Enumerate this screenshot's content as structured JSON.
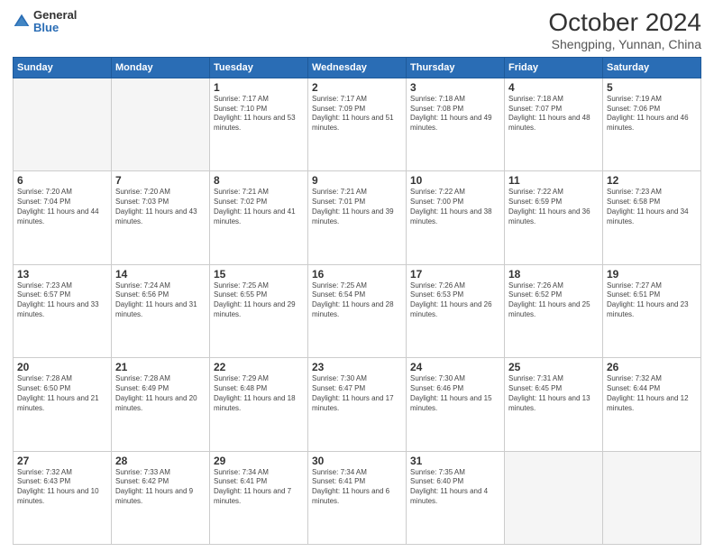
{
  "logo": {
    "general": "General",
    "blue": "Blue"
  },
  "title": "October 2024",
  "subtitle": "Shengping, Yunnan, China",
  "header_days": [
    "Sunday",
    "Monday",
    "Tuesday",
    "Wednesday",
    "Thursday",
    "Friday",
    "Saturday"
  ],
  "weeks": [
    [
      {
        "day": "",
        "sunrise": "",
        "sunset": "",
        "daylight": ""
      },
      {
        "day": "",
        "sunrise": "",
        "sunset": "",
        "daylight": ""
      },
      {
        "day": "1",
        "sunrise": "Sunrise: 7:17 AM",
        "sunset": "Sunset: 7:10 PM",
        "daylight": "Daylight: 11 hours and 53 minutes."
      },
      {
        "day": "2",
        "sunrise": "Sunrise: 7:17 AM",
        "sunset": "Sunset: 7:09 PM",
        "daylight": "Daylight: 11 hours and 51 minutes."
      },
      {
        "day": "3",
        "sunrise": "Sunrise: 7:18 AM",
        "sunset": "Sunset: 7:08 PM",
        "daylight": "Daylight: 11 hours and 49 minutes."
      },
      {
        "day": "4",
        "sunrise": "Sunrise: 7:18 AM",
        "sunset": "Sunset: 7:07 PM",
        "daylight": "Daylight: 11 hours and 48 minutes."
      },
      {
        "day": "5",
        "sunrise": "Sunrise: 7:19 AM",
        "sunset": "Sunset: 7:06 PM",
        "daylight": "Daylight: 11 hours and 46 minutes."
      }
    ],
    [
      {
        "day": "6",
        "sunrise": "Sunrise: 7:20 AM",
        "sunset": "Sunset: 7:04 PM",
        "daylight": "Daylight: 11 hours and 44 minutes."
      },
      {
        "day": "7",
        "sunrise": "Sunrise: 7:20 AM",
        "sunset": "Sunset: 7:03 PM",
        "daylight": "Daylight: 11 hours and 43 minutes."
      },
      {
        "day": "8",
        "sunrise": "Sunrise: 7:21 AM",
        "sunset": "Sunset: 7:02 PM",
        "daylight": "Daylight: 11 hours and 41 minutes."
      },
      {
        "day": "9",
        "sunrise": "Sunrise: 7:21 AM",
        "sunset": "Sunset: 7:01 PM",
        "daylight": "Daylight: 11 hours and 39 minutes."
      },
      {
        "day": "10",
        "sunrise": "Sunrise: 7:22 AM",
        "sunset": "Sunset: 7:00 PM",
        "daylight": "Daylight: 11 hours and 38 minutes."
      },
      {
        "day": "11",
        "sunrise": "Sunrise: 7:22 AM",
        "sunset": "Sunset: 6:59 PM",
        "daylight": "Daylight: 11 hours and 36 minutes."
      },
      {
        "day": "12",
        "sunrise": "Sunrise: 7:23 AM",
        "sunset": "Sunset: 6:58 PM",
        "daylight": "Daylight: 11 hours and 34 minutes."
      }
    ],
    [
      {
        "day": "13",
        "sunrise": "Sunrise: 7:23 AM",
        "sunset": "Sunset: 6:57 PM",
        "daylight": "Daylight: 11 hours and 33 minutes."
      },
      {
        "day": "14",
        "sunrise": "Sunrise: 7:24 AM",
        "sunset": "Sunset: 6:56 PM",
        "daylight": "Daylight: 11 hours and 31 minutes."
      },
      {
        "day": "15",
        "sunrise": "Sunrise: 7:25 AM",
        "sunset": "Sunset: 6:55 PM",
        "daylight": "Daylight: 11 hours and 29 minutes."
      },
      {
        "day": "16",
        "sunrise": "Sunrise: 7:25 AM",
        "sunset": "Sunset: 6:54 PM",
        "daylight": "Daylight: 11 hours and 28 minutes."
      },
      {
        "day": "17",
        "sunrise": "Sunrise: 7:26 AM",
        "sunset": "Sunset: 6:53 PM",
        "daylight": "Daylight: 11 hours and 26 minutes."
      },
      {
        "day": "18",
        "sunrise": "Sunrise: 7:26 AM",
        "sunset": "Sunset: 6:52 PM",
        "daylight": "Daylight: 11 hours and 25 minutes."
      },
      {
        "day": "19",
        "sunrise": "Sunrise: 7:27 AM",
        "sunset": "Sunset: 6:51 PM",
        "daylight": "Daylight: 11 hours and 23 minutes."
      }
    ],
    [
      {
        "day": "20",
        "sunrise": "Sunrise: 7:28 AM",
        "sunset": "Sunset: 6:50 PM",
        "daylight": "Daylight: 11 hours and 21 minutes."
      },
      {
        "day": "21",
        "sunrise": "Sunrise: 7:28 AM",
        "sunset": "Sunset: 6:49 PM",
        "daylight": "Daylight: 11 hours and 20 minutes."
      },
      {
        "day": "22",
        "sunrise": "Sunrise: 7:29 AM",
        "sunset": "Sunset: 6:48 PM",
        "daylight": "Daylight: 11 hours and 18 minutes."
      },
      {
        "day": "23",
        "sunrise": "Sunrise: 7:30 AM",
        "sunset": "Sunset: 6:47 PM",
        "daylight": "Daylight: 11 hours and 17 minutes."
      },
      {
        "day": "24",
        "sunrise": "Sunrise: 7:30 AM",
        "sunset": "Sunset: 6:46 PM",
        "daylight": "Daylight: 11 hours and 15 minutes."
      },
      {
        "day": "25",
        "sunrise": "Sunrise: 7:31 AM",
        "sunset": "Sunset: 6:45 PM",
        "daylight": "Daylight: 11 hours and 13 minutes."
      },
      {
        "day": "26",
        "sunrise": "Sunrise: 7:32 AM",
        "sunset": "Sunset: 6:44 PM",
        "daylight": "Daylight: 11 hours and 12 minutes."
      }
    ],
    [
      {
        "day": "27",
        "sunrise": "Sunrise: 7:32 AM",
        "sunset": "Sunset: 6:43 PM",
        "daylight": "Daylight: 11 hours and 10 minutes."
      },
      {
        "day": "28",
        "sunrise": "Sunrise: 7:33 AM",
        "sunset": "Sunset: 6:42 PM",
        "daylight": "Daylight: 11 hours and 9 minutes."
      },
      {
        "day": "29",
        "sunrise": "Sunrise: 7:34 AM",
        "sunset": "Sunset: 6:41 PM",
        "daylight": "Daylight: 11 hours and 7 minutes."
      },
      {
        "day": "30",
        "sunrise": "Sunrise: 7:34 AM",
        "sunset": "Sunset: 6:41 PM",
        "daylight": "Daylight: 11 hours and 6 minutes."
      },
      {
        "day": "31",
        "sunrise": "Sunrise: 7:35 AM",
        "sunset": "Sunset: 6:40 PM",
        "daylight": "Daylight: 11 hours and 4 minutes."
      },
      {
        "day": "",
        "sunrise": "",
        "sunset": "",
        "daylight": ""
      },
      {
        "day": "",
        "sunrise": "",
        "sunset": "",
        "daylight": ""
      }
    ]
  ]
}
